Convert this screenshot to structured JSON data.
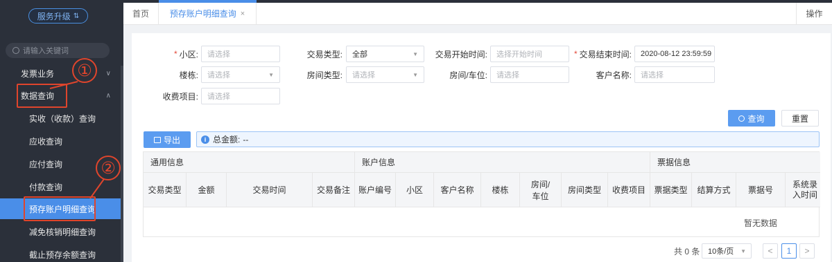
{
  "sidebar": {
    "upgrade_label": "服务升级",
    "search_placeholder": "请输入关键词",
    "groups": [
      {
        "label": "发票业务",
        "chevron": "∨"
      },
      {
        "label": "数据查询",
        "chevron": "∧"
      }
    ],
    "items": [
      {
        "label": "实收（收款）查询"
      },
      {
        "label": "应收查询"
      },
      {
        "label": "应付查询"
      },
      {
        "label": "付款查询"
      },
      {
        "label": "预存账户明细查询"
      },
      {
        "label": "减免核销明细查询"
      },
      {
        "label": "截止预存余额查询"
      }
    ],
    "annotations": [
      "①",
      "②"
    ]
  },
  "tabs": {
    "home": "首页",
    "active": "预存账户明细查询",
    "close": "×",
    "operation": "操作"
  },
  "filters": {
    "community_label": "小区:",
    "community_placeholder": "请选择",
    "trade_type_label": "交易类型:",
    "trade_type_value": "全部",
    "start_time_label": "交易开始时间:",
    "start_time_placeholder": "选择开始时间",
    "end_time_label": "交易结束时间:",
    "end_time_value": "2020-08-12 23:59:59",
    "building_label": "楼栋:",
    "building_placeholder": "请选择",
    "room_type_label": "房间类型:",
    "room_type_placeholder": "请选择",
    "room_label": "房间/车位:",
    "room_placeholder": "请选择",
    "customer_label": "客户名称:",
    "customer_placeholder": "请选择",
    "fee_item_label": "收费项目:",
    "fee_item_placeholder": "请选择"
  },
  "actions": {
    "query": "查询",
    "reset": "重置",
    "export": "导出"
  },
  "summary": {
    "total_label": "总金额:",
    "total_value": "--"
  },
  "table": {
    "groups": [
      "通用信息",
      "账户信息",
      "票据信息"
    ],
    "columns": [
      "交易类型",
      "金额",
      "交易时间",
      "交易备注",
      "账户编号",
      "小区",
      "客户名称",
      "楼栋",
      "房间/车位",
      "房间类型",
      "收费项目",
      "票据类型",
      "结算方式",
      "票据号",
      "系统录入时间"
    ],
    "empty_text": "暂无数据"
  },
  "pagination": {
    "total": "共 0 条",
    "page_size": "10条/页",
    "prev": "<",
    "current": "1",
    "next": ">"
  },
  "colors": {
    "sidebar_bg": "#2b303a",
    "accent": "#4a8ee8",
    "annotation": "#e0452c"
  }
}
